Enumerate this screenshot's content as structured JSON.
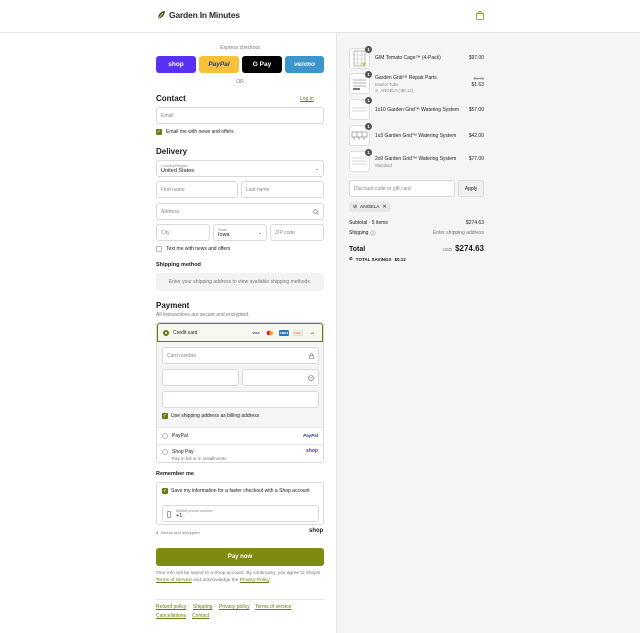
{
  "header": {
    "brand": "Garden In Minutes"
  },
  "express": {
    "title": "Express checkout",
    "buttons": [
      {
        "label": "shop",
        "bg": "#5a31f4"
      },
      {
        "label": "PayPal",
        "bg": "#f7c23a"
      },
      {
        "label": "G Pay",
        "bg": "#000000"
      },
      {
        "label": "venmo",
        "bg": "#3d95ce"
      }
    ],
    "or": "OR"
  },
  "contact": {
    "title": "Contact",
    "login": "Log in",
    "email_placeholder": "Email",
    "email_news": "Email me with news and offers"
  },
  "delivery": {
    "title": "Delivery",
    "country_label": "Country/Region",
    "country_value": "United States",
    "first_name": "First name",
    "last_name": "Last name",
    "address": "Address",
    "city": "City",
    "state_label": "State",
    "state_value": "Iowa",
    "zip": "ZIP code",
    "text_news": "Text me with news and offers"
  },
  "shipping": {
    "title": "Shipping method",
    "message": "Enter your shipping address to view available shipping methods."
  },
  "payment": {
    "title": "Payment",
    "subtitle": "All transactions are secure and encrypted.",
    "credit_card": "Credit card",
    "card_number": "Card number",
    "billing_same": "Use shipping address as billing address",
    "paypal": "PayPal",
    "shop_pay": "Shop Pay",
    "shop_pay_sub": "Pay in full or in installments",
    "card_logos": [
      "VISA",
      "MC",
      "AMEX",
      "DISC",
      "+4"
    ]
  },
  "remember": {
    "title": "Remember me",
    "save_info": "Save my information for a faster checkout with a Shop account",
    "phone_label": "Mobile phone number",
    "phone_value": "+1",
    "secure": "Secure and encrypted",
    "shop_word": "shop"
  },
  "pay_now": "Pay now",
  "disclaimer": {
    "pre": "Your info will be saved to a Shop account. By continuing, you agree to Shop's",
    "tos": "Terms of Service",
    "mid": "and acknowledge the",
    "privacy": "Privacy Policy",
    "end": "."
  },
  "footer": [
    "Refund policy",
    "Shipping",
    "Privacy policy",
    "Terms of service",
    "Cancellations",
    "Contact"
  ],
  "cart": {
    "items": [
      {
        "qty": "1",
        "name": "GIM Tomato Cage™ (4-Pack)",
        "sub": "",
        "discount": "",
        "old_price": "",
        "price": "$97.00"
      },
      {
        "qty": "1",
        "name": "Garden Grid™ Repair Parts",
        "sub": "Interior Tube",
        "discount": "ANGELA (-$0.12)",
        "old_price": "$1.75",
        "price": "$1.63"
      },
      {
        "qty": "1",
        "name": "1x10 Garden Grid™ Watering System",
        "sub": "",
        "discount": "",
        "old_price": "",
        "price": "$57.00"
      },
      {
        "qty": "1",
        "name": "1x3 Garden Grid™ Watering System",
        "sub": "",
        "discount": "",
        "old_price": "",
        "price": "$42.00"
      },
      {
        "qty": "1",
        "name": "2x9 Garden Grid™ Watering System",
        "sub": "Standard",
        "discount": "",
        "old_price": "",
        "price": "$77.00"
      }
    ],
    "discount_placeholder": "Discount code or gift card",
    "apply": "Apply",
    "code": "ANGELA",
    "subtotal_label": "Subtotal · 5 items",
    "subtotal": "$274.63",
    "shipping_label": "Shipping",
    "shipping_value": "Enter shipping address",
    "total_label": "Total",
    "currency": "USD",
    "total": "$274.63",
    "savings_label": "TOTAL SAVINGS",
    "savings": "$0.12"
  },
  "colors": {
    "accent": "#7f8b0f",
    "bg_right": "#f5f5f5"
  }
}
